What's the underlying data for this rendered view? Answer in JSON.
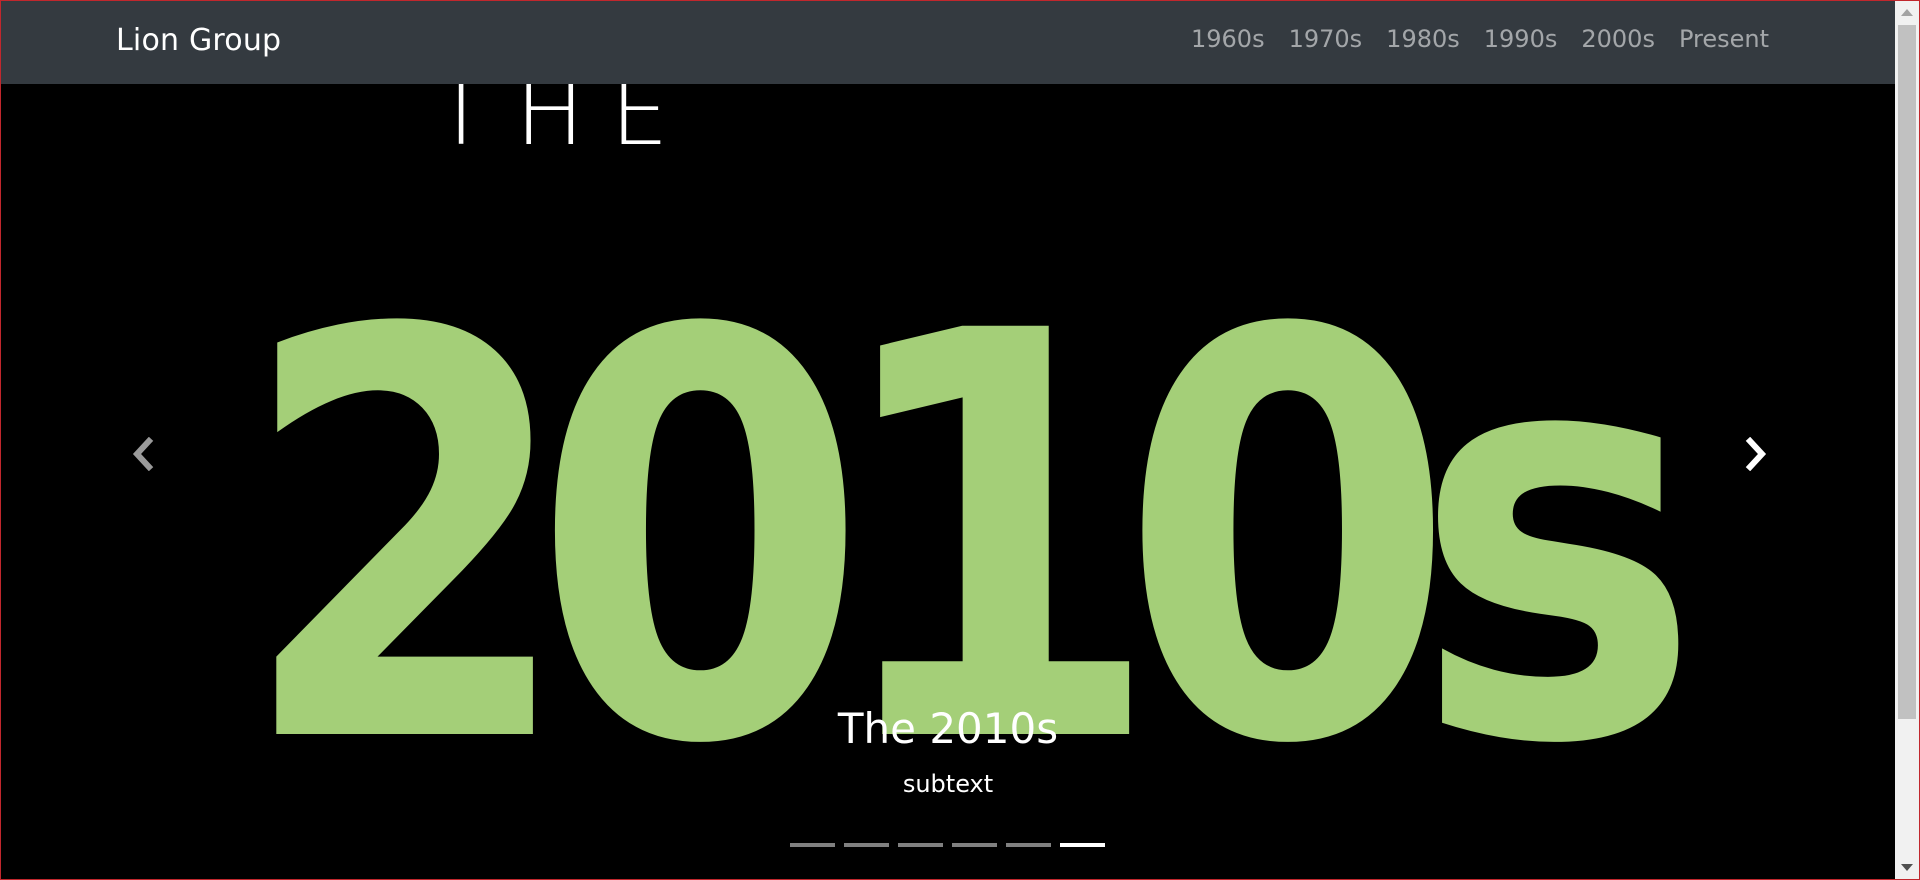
{
  "navbar": {
    "brand": "Lion Group",
    "links": [
      "1960s",
      "1970s",
      "1980s",
      "1990s",
      "2000s",
      "Present"
    ]
  },
  "carousel": {
    "art": {
      "top_word": "THE",
      "big_text": "2010s",
      "fill_color": "#a4cf78"
    },
    "caption_title": "The 2010s",
    "caption_subtext": "subtext",
    "slide_count": 6,
    "active_slide": 6,
    "prev_icon": "chevron-left-icon",
    "next_icon": "chevron-right-icon"
  }
}
